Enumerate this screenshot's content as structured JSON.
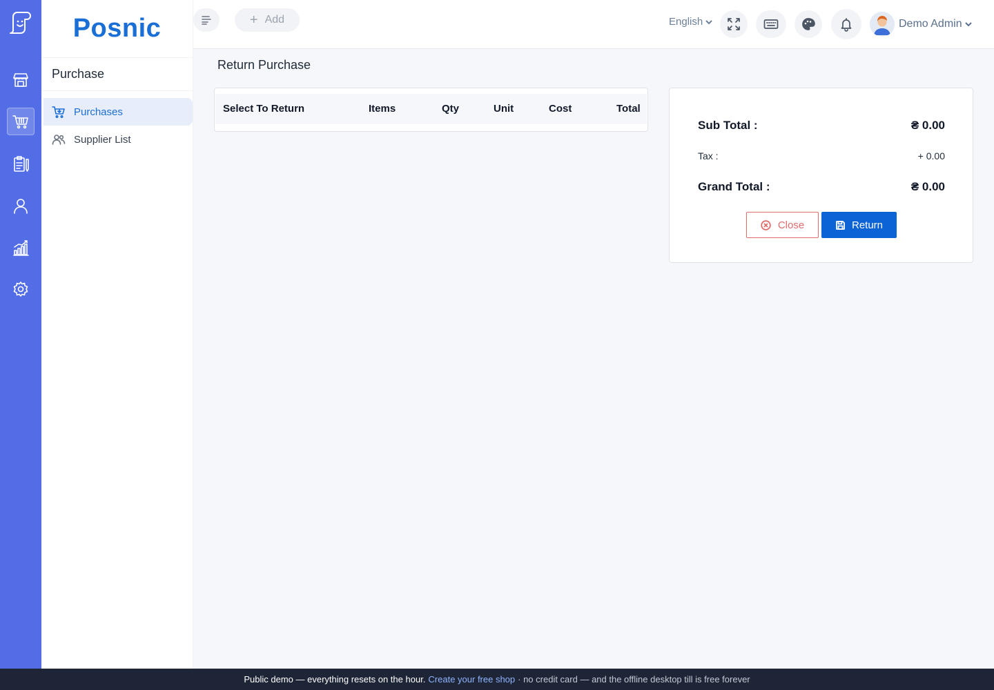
{
  "brand": {
    "name": "Posnic"
  },
  "sidebar": {
    "section_title": "Purchase",
    "items": [
      {
        "label": "Purchases",
        "icon": "cart-icon",
        "active": true
      },
      {
        "label": "Supplier List",
        "icon": "users-icon",
        "active": false
      }
    ]
  },
  "rail": {
    "items": [
      {
        "icon": "store-icon"
      },
      {
        "icon": "shopping-basket-icon",
        "active": true
      },
      {
        "icon": "clipboard-icon"
      },
      {
        "icon": "user-icon"
      },
      {
        "icon": "bar-chart-icon"
      },
      {
        "icon": "gear-icon"
      }
    ]
  },
  "topbar": {
    "add_label": "Add",
    "language": "English",
    "user_name": "Demo Admin"
  },
  "main": {
    "title": "Return Purchase",
    "table": {
      "columns": [
        "Select To Return",
        "Items",
        "Qty",
        "Unit",
        "Cost",
        "Total"
      ],
      "rows": []
    },
    "summary": {
      "sub_total_label": "Sub Total :",
      "sub_total_value": "₴ 0.00",
      "tax_label": "Tax :",
      "tax_value": "+ 0.00",
      "grand_total_label": "Grand Total :",
      "grand_total_value": "₴ 0.00",
      "close_label": "Close",
      "return_label": "Return"
    }
  },
  "footer": {
    "text_start": "Public demo — everything resets on the hour.",
    "link": "Create your free shop",
    "text_end": "· no credit card — and the offline desktop till is free forever"
  },
  "colors": {
    "rail": "#536de6",
    "primary": "#0b63d6",
    "brand": "#1a6fd6",
    "danger": "#e06c6c"
  }
}
